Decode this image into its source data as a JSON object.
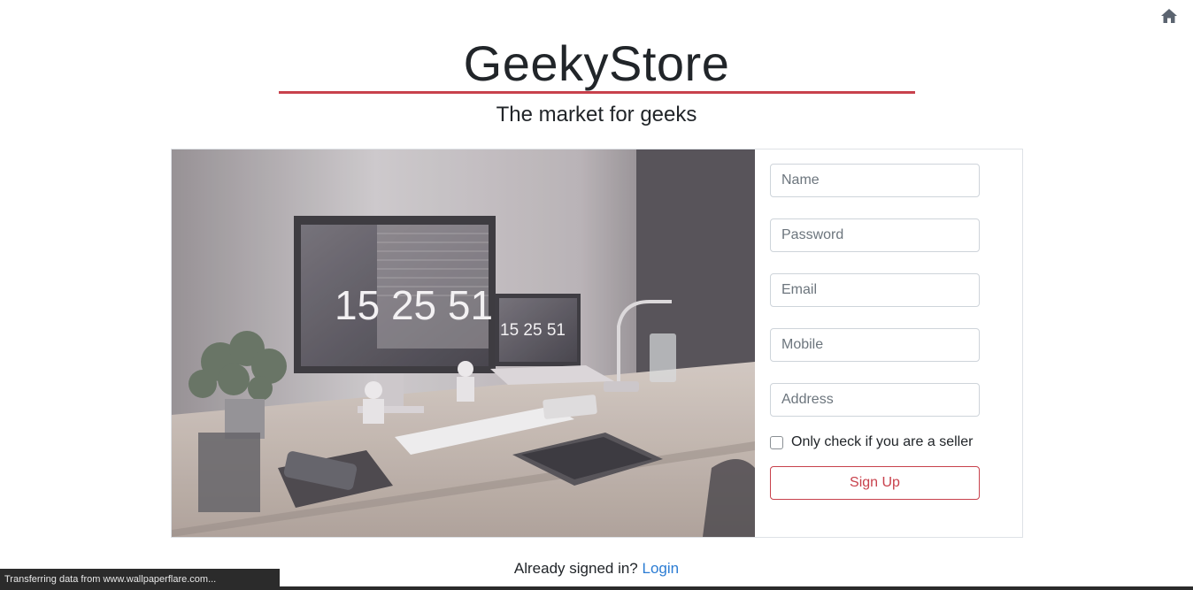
{
  "nav": {
    "home_icon": "home-icon",
    "icon_color": "#5b6470"
  },
  "brand": {
    "title": "GeekyStore",
    "tagline": "The market for geeks",
    "accent_color": "#c8414c"
  },
  "hero": {
    "monitor_clock": "15 25 51",
    "laptop_clock": "15 25 51"
  },
  "form": {
    "name_placeholder": "Name",
    "password_placeholder": "Password",
    "email_placeholder": "Email",
    "mobile_placeholder": "Mobile",
    "address_placeholder": "Address",
    "seller_label": "Only check if you are a seller",
    "seller_checked": false,
    "signup_label": "Sign Up"
  },
  "footer": {
    "prompt": "Already signed in?",
    "login_label": "Login",
    "link_color": "#2b7cd3"
  },
  "browser": {
    "status_text": "Transferring data from www.wallpaperflare.com..."
  }
}
